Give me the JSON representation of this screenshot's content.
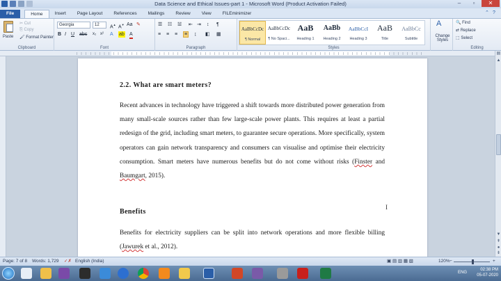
{
  "window": {
    "title": "Data Science and Ethical Issues-part 1 - Microsoft Word (Product Activation Failed)"
  },
  "tabs": [
    "File",
    "Home",
    "Insert",
    "Page Layout",
    "References",
    "Mailings",
    "Review",
    "View",
    "FILEminimizer"
  ],
  "ribbon": {
    "clipboard": {
      "label": "Clipboard",
      "paste": "Paste",
      "cut": "Cut",
      "copy": "Copy",
      "format_painter": "Format Painter"
    },
    "font": {
      "label": "Font",
      "family": "Georgia",
      "size": "12"
    },
    "paragraph": {
      "label": "Paragraph"
    },
    "styles": {
      "label": "Styles",
      "items": [
        {
          "preview": "AaBbCcDc",
          "name": "¶ Normal"
        },
        {
          "preview": "AaBbCcDc",
          "name": "¶ No Spaci..."
        },
        {
          "preview": "AaB",
          "name": "Heading 1"
        },
        {
          "preview": "AaBb",
          "name": "Heading 2"
        },
        {
          "preview": "AaBbCcI",
          "name": "Heading 3"
        },
        {
          "preview": "AaB",
          "name": "Title"
        },
        {
          "preview": "AaBbCc",
          "name": "Subtitle"
        }
      ],
      "change_styles": "Change Styles"
    },
    "editing": {
      "label": "Editing",
      "find": "Find",
      "replace": "Replace",
      "select": "Select"
    }
  },
  "document": {
    "heading": "2.2. What are smart meters?",
    "para1_a": "Recent advances in technology have triggered a shift towards more distributed power generation from many small-scale sources rather than few large-scale power plants. This requires at least a partial redesign of the grid, including smart meters, to guarantee secure operations. More specifically, system operators can gain network transparency and consumers can visualise and optimise their electricity consumption. Smart meters have numerous benefits but do not come without risks (",
    "para1_link": "Finster",
    "para1_b": " and ",
    "para1_link2": "Baumgart",
    "para1_c": ", 2015).",
    "subheading": "Benefits",
    "para2_a": "Benefits for electricity suppliers can be split into network operations and more flexible billing (",
    "para2_link": "Jawurek",
    "para2_b": " et al., 2012)."
  },
  "status": {
    "page": "Page: 7 of 8",
    "words": "Words: 1,729",
    "language": "English (India)",
    "zoom": "120%"
  },
  "taskbar": {
    "lang": "ENG",
    "time": "02:38 PM",
    "date": "05-07-2020"
  }
}
